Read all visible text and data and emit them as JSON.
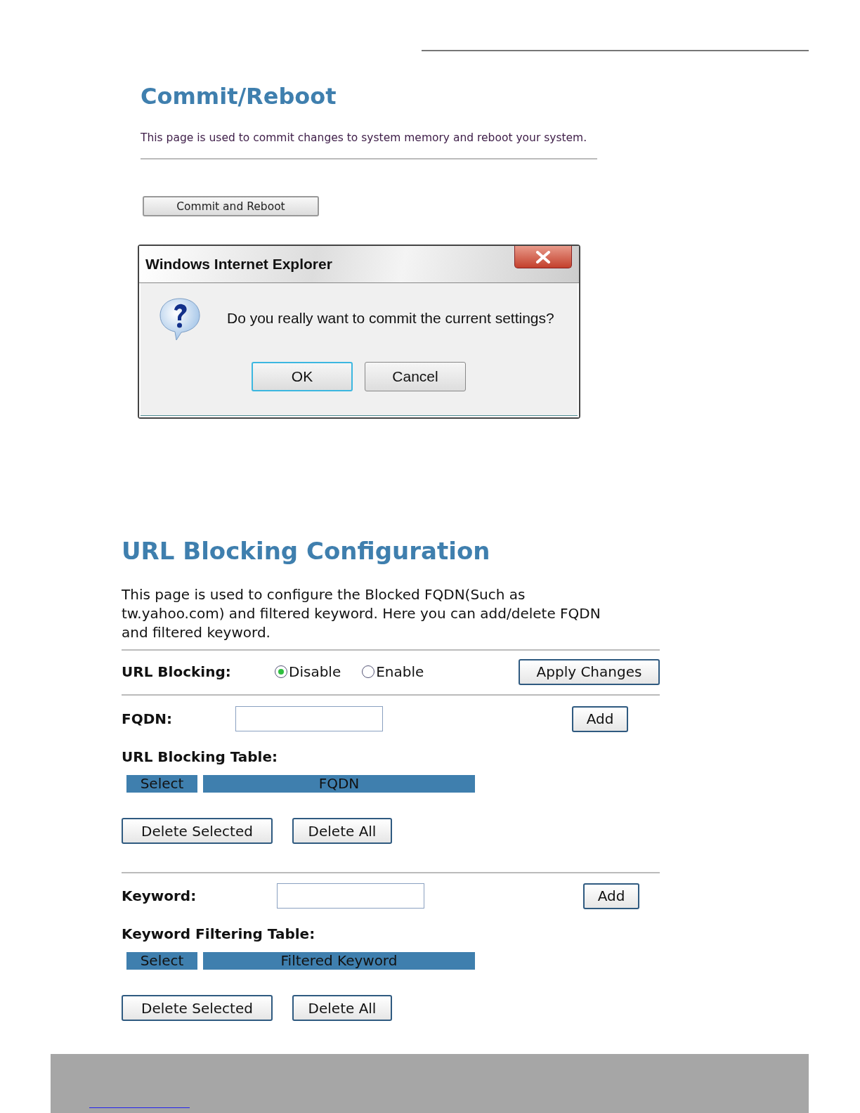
{
  "commit_section": {
    "title": "Commit/Reboot",
    "description": "This page is used to commit changes to system memory and reboot your system.",
    "button": "Commit and Reboot"
  },
  "dialog": {
    "title": "Windows Internet Explorer",
    "message": "Do you really want to commit the current settings?",
    "buttons": [
      {
        "label": "OK",
        "focused": true
      },
      {
        "label": "Cancel",
        "focused": false
      }
    ]
  },
  "url_blocking": {
    "title": "URL Blocking Configuration",
    "description": "This page is used to configure the Blocked FQDN(Such as tw.yahoo.com) and filtered keyword. Here you can add/delete FQDN and filtered keyword.",
    "mode": {
      "label": "URL Blocking:",
      "options": [
        {
          "label": "Disable",
          "selected": true
        },
        {
          "label": "Enable",
          "selected": false
        }
      ],
      "apply_button": "Apply Changes"
    },
    "sections": [
      {
        "field_label": "FQDN:",
        "add_button": "Add",
        "table_title": "URL Blocking Table:",
        "columns": [
          "Select",
          "FQDN"
        ],
        "buttons": [
          "Delete Selected",
          "Delete All"
        ]
      },
      {
        "field_label": "Keyword:",
        "add_button": "Add",
        "table_title": "Keyword Filtering Table:",
        "columns": [
          "Select",
          "Filtered Keyword"
        ],
        "buttons": [
          "Delete Selected",
          "Delete All"
        ]
      }
    ]
  }
}
